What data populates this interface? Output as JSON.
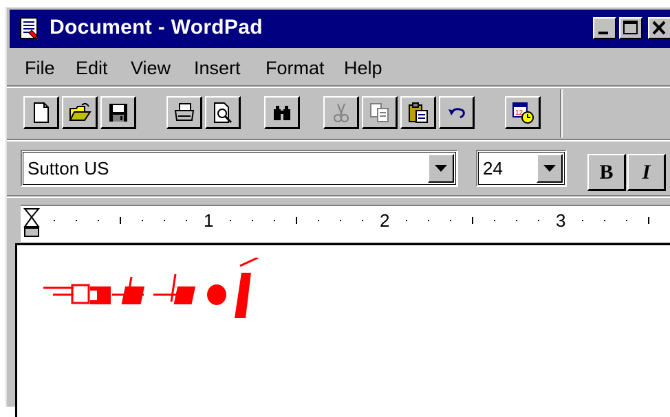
{
  "window": {
    "title": "Document - WordPad"
  },
  "menu": {
    "items": [
      "File",
      "Edit",
      "View",
      "Insert",
      "Format",
      "Help"
    ]
  },
  "toolbar": {
    "buttons": [
      "new-icon",
      "open-icon",
      "save-icon",
      "print-icon",
      "print-preview-icon",
      "find-icon",
      "cut-icon",
      "copy-icon",
      "paste-icon",
      "undo-icon",
      "date-time-icon"
    ]
  },
  "format_bar": {
    "font_name": "Sutton US",
    "font_size": "24",
    "bold_label": "B",
    "italic_label": "I"
  },
  "ruler": {
    "numbers": [
      "1",
      "2",
      "3"
    ]
  },
  "document": {
    "text_color": "#ff0000"
  },
  "colors": {
    "titlebar": "#000080",
    "face": "#c0c0c0"
  }
}
